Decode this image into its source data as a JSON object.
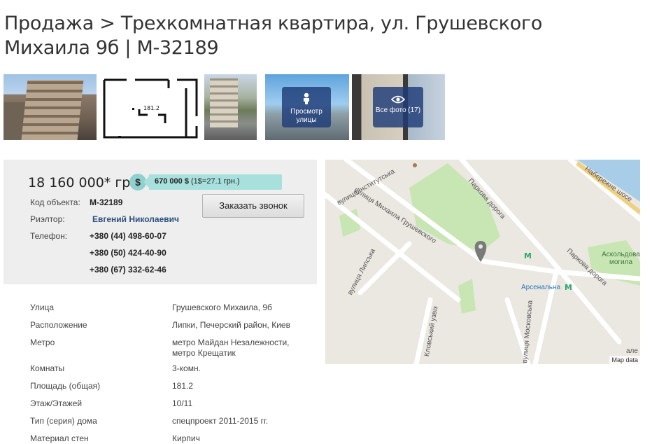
{
  "page": {
    "title": "Продажа > Трехкомнатная квартира, ул. Грушевского Михаила 9б | M-32189"
  },
  "gallery": {
    "floorplan_label": "181.2",
    "street_view_label": "Просмотр улицы",
    "all_photos_label": "Все фото (17)"
  },
  "offer": {
    "price_uah": "18 160 000* грн.",
    "price_usd": "670 000 $",
    "rate": "(1$=27.1 грн.)",
    "currency_icon": "$",
    "object_code_label": "Код объекта:",
    "object_code": "M-32189",
    "realtor_label": "Риэлтор:",
    "realtor_name": "Евгений Николаевич",
    "phone_label": "Телефон:",
    "phones": [
      "+380 (44) 498-60-07",
      "+380 (50) 424-40-90",
      "+380 (67) 332-62-46"
    ],
    "order_call_label": "Заказать звонок"
  },
  "properties": [
    {
      "label": "Улица",
      "value": "Грушевского Михаила, 9б"
    },
    {
      "label": "Расположение",
      "value": "Липки, Печерский район, Киев"
    },
    {
      "label": "Метро",
      "value": "метро Майдан Незалежности, метро Крещатик"
    },
    {
      "label": "Комнаты",
      "value": "3-комн."
    },
    {
      "label": "Площадь (общая)",
      "value": "181.2"
    },
    {
      "label": "Этаж/Этажей",
      "value": "10/11"
    },
    {
      "label": "Тип (серия) дома",
      "value": "спецпроект 2011-2015 гг."
    },
    {
      "label": "Материал стен",
      "value": "Кирпич"
    }
  ],
  "map": {
    "labels": {
      "street_hrushevskoho": "вулиця Михаила Грушевского",
      "street_instytutska": "вулиця Інститутська",
      "street_lypska": "вулиця Липська",
      "parkova_doroha_1": "Паркова дорога",
      "parkova_doroha_2": "Паркова дорога",
      "naberezhne": "Набережне шосе",
      "askoldova": "Аскольдова могила",
      "arsenalna": "Арсенальна",
      "klovskyi": "Кловський узвіз",
      "moskovska": "вулиця Московська",
      "ale": "але"
    },
    "attribution": "Map data",
    "colors": {
      "park": "#c8e6b4",
      "road": "#ffffff",
      "water": "#a8cde8",
      "metro": "#2ea86f",
      "marker": "#7a7a7a"
    }
  }
}
